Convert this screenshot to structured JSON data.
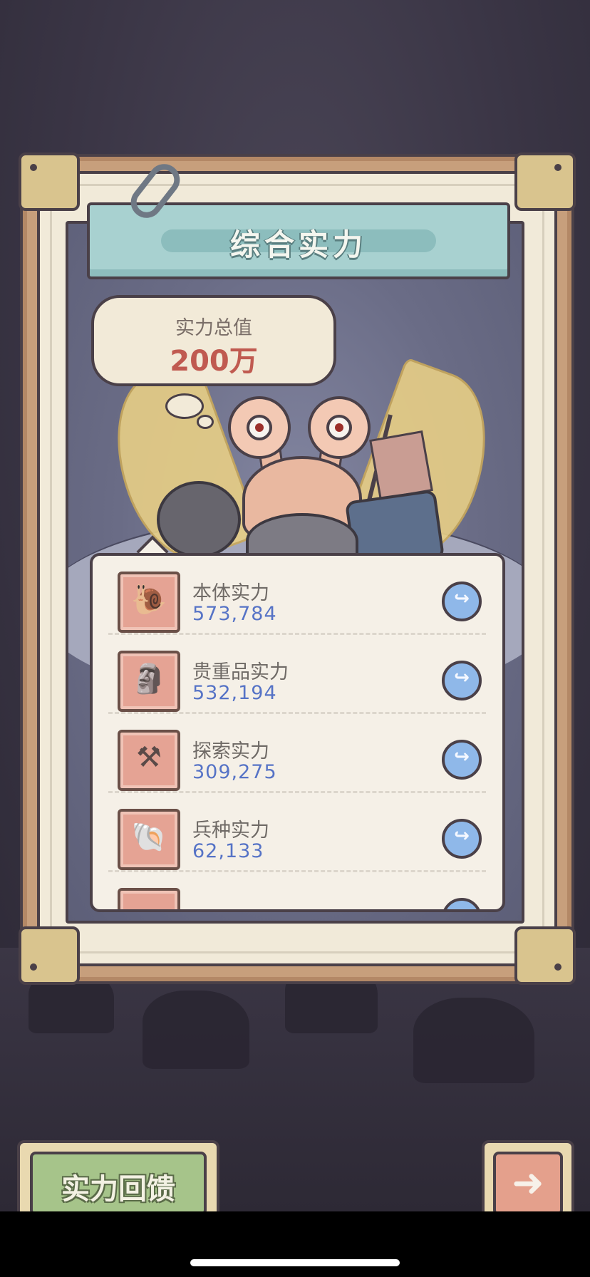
{
  "header": {
    "title": "综合实力"
  },
  "total": {
    "label": "实力总值",
    "value": "200万"
  },
  "power_list": [
    {
      "name": "本体实力",
      "value": "573,784",
      "icon": "snail-icon"
    },
    {
      "name": "贵重品实力",
      "value": "532,194",
      "icon": "bust-icon"
    },
    {
      "name": "探索实力",
      "value": "309,275",
      "icon": "explore-icon"
    },
    {
      "name": "兵种实力",
      "value": "62,133",
      "icon": "troop-icon"
    }
  ],
  "footer": {
    "feedback_label": "实力回馈",
    "next_icon": "arrow-right-icon"
  },
  "colors": {
    "value_blue": "#5673c6",
    "total_red": "#c05a50",
    "banner_teal": "#a8d1d0",
    "button_green": "#a6c48a",
    "button_salmon": "#e4a08c"
  }
}
